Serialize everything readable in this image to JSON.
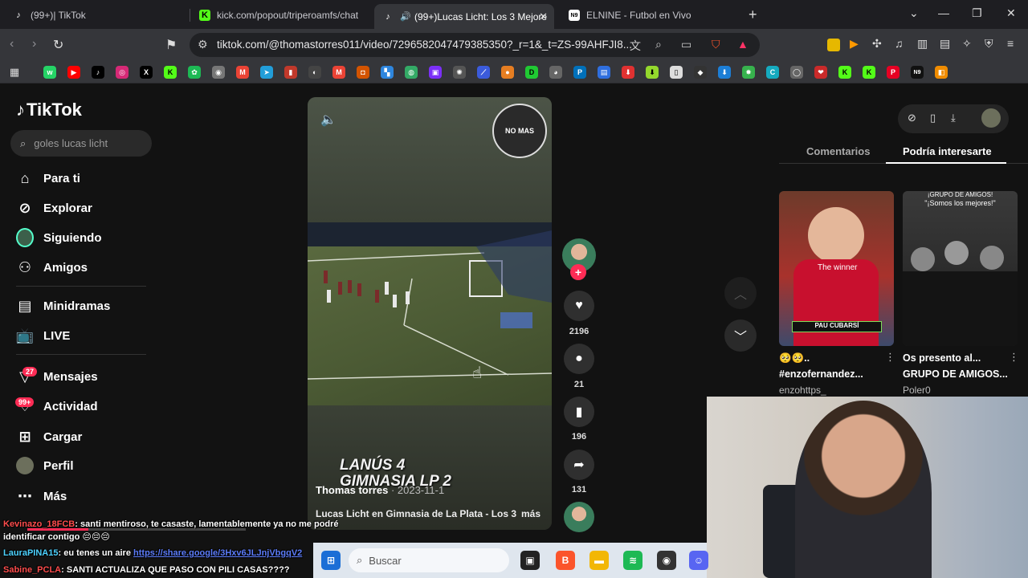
{
  "browser": {
    "tabs": [
      {
        "label": "(99+)| TikTok",
        "active": false
      },
      {
        "label": "kick.com/popout/triperoamfs/chat",
        "active": false
      },
      {
        "label": "(99+)Lucas Licht: Los 3 Mejore",
        "active": true
      },
      {
        "label": "ELNINE - Futbol en Vivo",
        "active": false
      }
    ],
    "url": "tiktok.com/@thomastorres011/video/7296582047479385350?_r=1&_t=ZS-99AHFJI8...",
    "new_tab": "+",
    "brave_shield_count": "6"
  },
  "tiktok": {
    "logo": "TikTok",
    "search_value": "goles lucas licht",
    "nav": [
      {
        "label": "Para ti",
        "icon": "home-icon"
      },
      {
        "label": "Explorar",
        "icon": "compass-icon"
      },
      {
        "label": "Siguiendo",
        "icon": "following-avatar-icon"
      },
      {
        "label": "Amigos",
        "icon": "friends-icon"
      },
      {
        "label": "Minidramas",
        "icon": "film-icon"
      },
      {
        "label": "LIVE",
        "icon": "live-tv-icon"
      },
      {
        "label": "Mensajes",
        "icon": "messages-icon",
        "badge": "27"
      },
      {
        "label": "Actividad",
        "icon": "activity-icon",
        "badge": "99+"
      },
      {
        "label": "Cargar",
        "icon": "upload-icon"
      },
      {
        "label": "Perfil",
        "icon": "profile-avatar-icon"
      },
      {
        "label": "Más",
        "icon": "more-icon"
      }
    ],
    "video": {
      "watermark": "NO MAS",
      "overlay_line1": "LANÚS 4",
      "overlay_line2": "GIMNASIA LP 2",
      "author": "Thomas torres",
      "date": "· 2023-11-1",
      "description": "Lucas Licht en Gimnasia de La Plata - Los 3",
      "more": "más",
      "progress": 0.28
    },
    "actions": {
      "likes": "2196",
      "comments": "21",
      "saves": "196",
      "shares": "131"
    },
    "right_tabs": {
      "comments": "Comentarios",
      "suggested": "Podría interesarte"
    },
    "cards": [
      {
        "title": "#enzofernandez...",
        "emoji_line": "🥺🥺..",
        "user": "enzohttps_",
        "caption": "The winner",
        "banner": "PAU CUBARSÍ"
      },
      {
        "title": "Os presento al... GRUPO DE AMIGOS...",
        "title_line1": "Os presento al...",
        "title_line2": "GRUPO DE AMIGOS...",
        "user": "Poler0",
        "caption": "\"¡Somos los mejores!\"",
        "header": "¡GRUPO DE AMIGOS!"
      }
    ]
  },
  "stream_chat": [
    {
      "user": "Kevinazo_18FCB",
      "user_color": "#ff4d4d",
      "text": ": santi mentiroso, te casaste, lamentablemente ya no me podré"
    },
    {
      "user": "",
      "user_color": "#ffffff",
      "text": "identificar contigo 😔😔😔"
    },
    {
      "user": "LauraPINA15",
      "user_color": "#4dd2ff",
      "text": ": eu tenes un aire",
      "link": "https://share.google/3Hxv6JLJnjVbgqV2"
    },
    {
      "user": "Sabine_PCLA",
      "user_color": "#ff4d4d",
      "text": ": SANTI ACTUALIZA QUE PASO CON PILI CASAS????"
    }
  ],
  "taskbar": {
    "search_placeholder": "Buscar"
  },
  "colors": {
    "accent": "#fe2c55",
    "page_bg": "#121212",
    "chrome_bg": "#35363a"
  }
}
